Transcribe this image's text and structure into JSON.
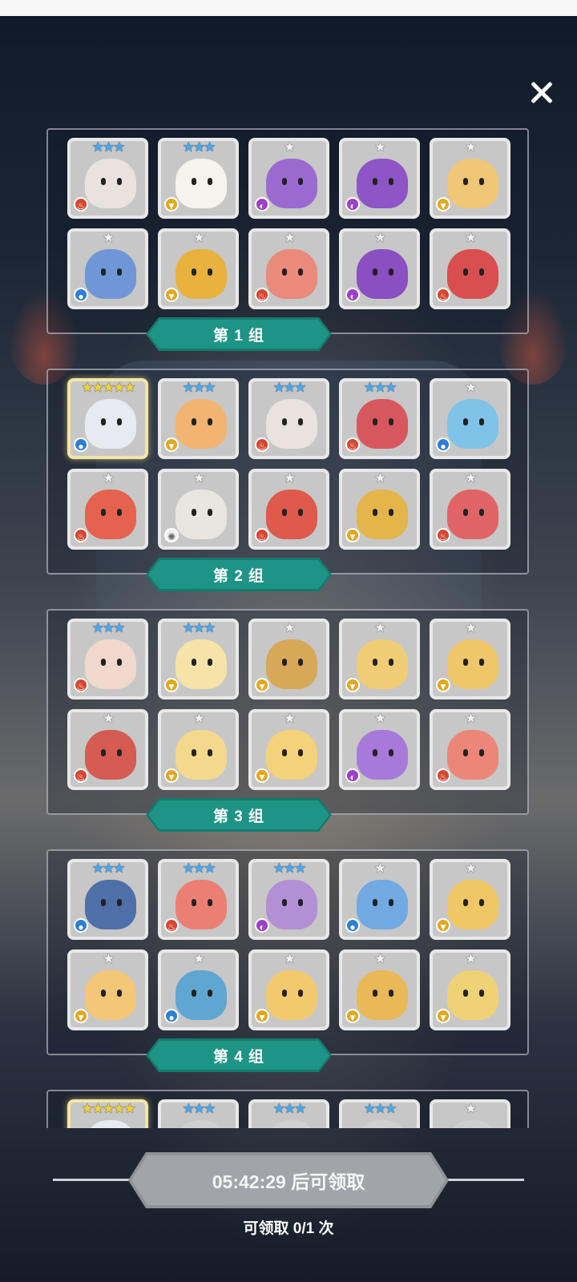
{
  "colors": {
    "accent_banner": "#1d9486",
    "button_disabled": "#a1a5a9",
    "element_fire": "#d9462f",
    "element_water": "#2d7fd8",
    "element_wind": "#e2a81c",
    "element_dark": "#9c3fc9",
    "element_light": "#f0f0f0"
  },
  "close_icon": "close-icon",
  "groups": [
    {
      "label": "第 1 组",
      "heroes": [
        {
          "stars": 3,
          "element": "fire",
          "color": "#e9e2de"
        },
        {
          "stars": 3,
          "element": "wind",
          "color": "#f6f2ee"
        },
        {
          "stars": 1,
          "element": "dark",
          "color": "#9b6ad1"
        },
        {
          "stars": 1,
          "element": "dark",
          "color": "#8d55c6"
        },
        {
          "stars": 1,
          "element": "wind",
          "color": "#f0c677"
        },
        {
          "stars": 1,
          "element": "water",
          "color": "#6f97d8"
        },
        {
          "stars": 1,
          "element": "wind",
          "color": "#e8b23d"
        },
        {
          "stars": 1,
          "element": "fire",
          "color": "#e98a7a"
        },
        {
          "stars": 1,
          "element": "dark",
          "color": "#8a4fc0"
        },
        {
          "stars": 1,
          "element": "fire",
          "color": "#d94f4f"
        }
      ]
    },
    {
      "label": "第 2 组",
      "heroes": [
        {
          "stars": 5,
          "element": "water",
          "color": "#e7eaf0",
          "gold": true
        },
        {
          "stars": 3,
          "element": "wind",
          "color": "#f2b470"
        },
        {
          "stars": 3,
          "element": "fire",
          "color": "#e9e2de"
        },
        {
          "stars": 3,
          "element": "fire",
          "color": "#d8575f"
        },
        {
          "stars": 1,
          "element": "water",
          "color": "#7fc3e8"
        },
        {
          "stars": 1,
          "element": "fire",
          "color": "#e5634e"
        },
        {
          "stars": 1,
          "element": "light",
          "color": "#e9e6e1"
        },
        {
          "stars": 1,
          "element": "fire",
          "color": "#dd5a4c"
        },
        {
          "stars": 1,
          "element": "wind",
          "color": "#e3b54a"
        },
        {
          "stars": 1,
          "element": "fire",
          "color": "#e06466"
        }
      ]
    },
    {
      "label": "第 3 组",
      "heroes": [
        {
          "stars": 3,
          "element": "fire",
          "color": "#f0d8cc"
        },
        {
          "stars": 3,
          "element": "wind",
          "color": "#f5e3a8"
        },
        {
          "stars": 1,
          "element": "wind",
          "color": "#d7a857"
        },
        {
          "stars": 1,
          "element": "wind",
          "color": "#f0cd74"
        },
        {
          "stars": 1,
          "element": "wind",
          "color": "#efc66a"
        },
        {
          "stars": 1,
          "element": "fire",
          "color": "#d65b52"
        },
        {
          "stars": 1,
          "element": "wind",
          "color": "#f2d98c"
        },
        {
          "stars": 1,
          "element": "wind",
          "color": "#f3d279"
        },
        {
          "stars": 1,
          "element": "dark",
          "color": "#a77ad9"
        },
        {
          "stars": 1,
          "element": "fire",
          "color": "#ec8678"
        }
      ]
    },
    {
      "label": "第 4 组",
      "heroes": [
        {
          "stars": 3,
          "element": "water",
          "color": "#4f6fa8"
        },
        {
          "stars": 3,
          "element": "fire",
          "color": "#ec7f74"
        },
        {
          "stars": 3,
          "element": "dark",
          "color": "#b38fd6"
        },
        {
          "stars": 1,
          "element": "water",
          "color": "#71a9e3"
        },
        {
          "stars": 1,
          "element": "wind",
          "color": "#f0c766"
        },
        {
          "stars": 1,
          "element": "wind",
          "color": "#f3c777"
        },
        {
          "stars": 1,
          "element": "water",
          "color": "#5fa6d2"
        },
        {
          "stars": 1,
          "element": "wind",
          "color": "#f2c96c"
        },
        {
          "stars": 1,
          "element": "wind",
          "color": "#e9b957"
        },
        {
          "stars": 1,
          "element": "wind",
          "color": "#f0d276"
        }
      ]
    },
    {
      "label": "",
      "heroes": [
        {
          "stars": 5,
          "element": "water",
          "color": "#e7eaf0",
          "gold": true
        },
        {
          "stars": 3,
          "element": "wind",
          "color": "#d0d0d0"
        },
        {
          "stars": 3,
          "element": "fire",
          "color": "#d0d0d0"
        },
        {
          "stars": 3,
          "element": "fire",
          "color": "#d0d0d0"
        },
        {
          "stars": 1,
          "element": "water",
          "color": "#d0d0d0"
        }
      ]
    }
  ],
  "claim_button": {
    "label": "05:42:29 后可领取"
  },
  "claim_count": {
    "text": "可领取 0/1 次"
  }
}
